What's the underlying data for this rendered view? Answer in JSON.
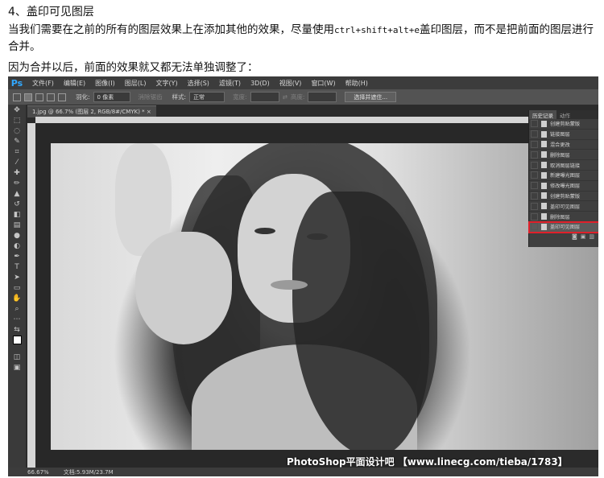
{
  "article": {
    "heading": "4、盖印可见图层",
    "para1_a": "当我们需要在之前的所有的图层效果上在添加其他的效果，尽量使用",
    "para1_shortcut": "ctrl+shift+alt+e",
    "para1_b": "盖印图层，而不是把前面的图层进行合并。",
    "para2": "因为合并以后，前面的效果就又都无法单独调整了："
  },
  "app": {
    "logo": "Ps",
    "menu": [
      "文件(F)",
      "编辑(E)",
      "图像(I)",
      "图层(L)",
      "文字(Y)",
      "选择(S)",
      "滤镜(T)",
      "3D(D)",
      "视图(V)",
      "窗口(W)",
      "帮助(H)"
    ]
  },
  "options": {
    "feather_label": "羽化:",
    "feather_value": "0 像素",
    "antialias": "消除锯齿",
    "style_label": "样式:",
    "style_value": "正常",
    "width_label": "宽度:",
    "height_label": "高度:",
    "refine_button": "选择并遮住..."
  },
  "document": {
    "tab": "1.jpg @ 66.7% (图层 2, RGB/8#/CMYK) *  ×"
  },
  "history_panel": {
    "tab_history": "历史记录",
    "tab_actions": "动作",
    "items": [
      "创建剪贴蒙版",
      "链接图层",
      "混合更改",
      "删除图层",
      "取消图层链接",
      "新建曝光图层",
      "修改曝光图层",
      "创建剪贴蒙版",
      "盖印可见图层",
      "删除图层",
      "盖印可见图层"
    ],
    "selected_index": 10
  },
  "watermark": "PhotoShop平面设计吧 【www.linecg.com/tieba/1783】",
  "status": {
    "zoom": "66.67%",
    "doc": "文档:5.93M/23.7M"
  },
  "colors": {
    "ps_blue": "#31a8ff",
    "highlight_red": "#e0202a"
  }
}
